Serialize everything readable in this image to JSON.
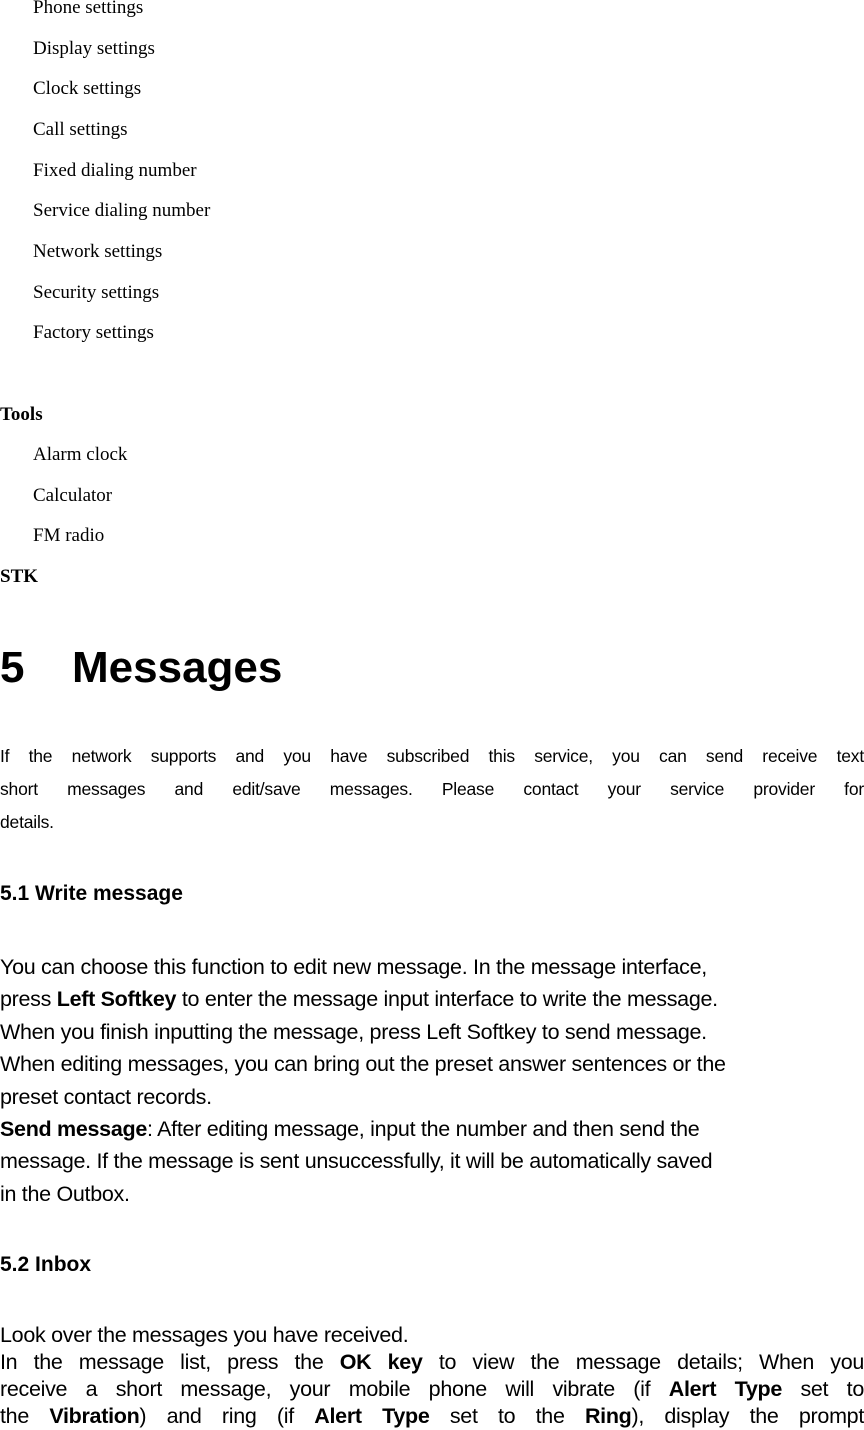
{
  "settings_items": [
    "Phone settings",
    "Display settings",
    "Clock settings",
    "Call settings",
    "Fixed dialing number",
    "Service dialing number",
    "Network settings",
    "Security settings",
    "Factory settings"
  ],
  "tools": {
    "heading": "Tools",
    "items": [
      "Alarm clock",
      "Calculator",
      "FM radio"
    ]
  },
  "stk": {
    "heading": "STK"
  },
  "chapter": {
    "number": "5",
    "title": "Messages",
    "intro": {
      "line1": "If the network supports and you have subscribed this service, you can send receive text",
      "line2": "short messages and edit/save messages.  Please contact your service provider for",
      "line3": "details."
    }
  },
  "section_5_1": {
    "title": "5.1 Write message",
    "p1_line1": "You can choose this function to edit new message. In the message interface,",
    "p1_line2_pre": "press ",
    "p1_line2_bold": "Left Softkey",
    "p1_line2_post": " to enter the message input interface to write the message.",
    "p1_line3": "When you finish inputting the message, press Left Softkey to send message.",
    "p1_line4": "When editing messages, you can bring out the preset answer sentences or the",
    "p1_line5": "preset contact records.",
    "p2_bold": "Send message",
    "p2_line1_post": ": After editing message, input the number and then send the",
    "p2_line2": "message. If the message is sent unsuccessfully, it will be automatically saved",
    "p2_line3": "in the Outbox."
  },
  "section_5_2": {
    "title": "5.2 Inbox",
    "p1": "Look over the messages you have received.",
    "p2_l1_a": "In the message list, press the ",
    "p2_l1_b": "OK key",
    "p2_l1_c": " to view the message details; When you",
    "p2_l2_a": "receive a short message, your mobile phone will vibrate (if ",
    "p2_l2_b": "Alert Type",
    "p2_l2_c": " set to",
    "p2_l3_a": "the ",
    "p2_l3_b": "Vibration",
    "p2_l3_c": ") and ring (if ",
    "p2_l3_d": "Alert Type",
    "p2_l3_e": " set to the ",
    "p2_l3_f": "Ring",
    "p2_l3_g": "), display the prompt"
  }
}
